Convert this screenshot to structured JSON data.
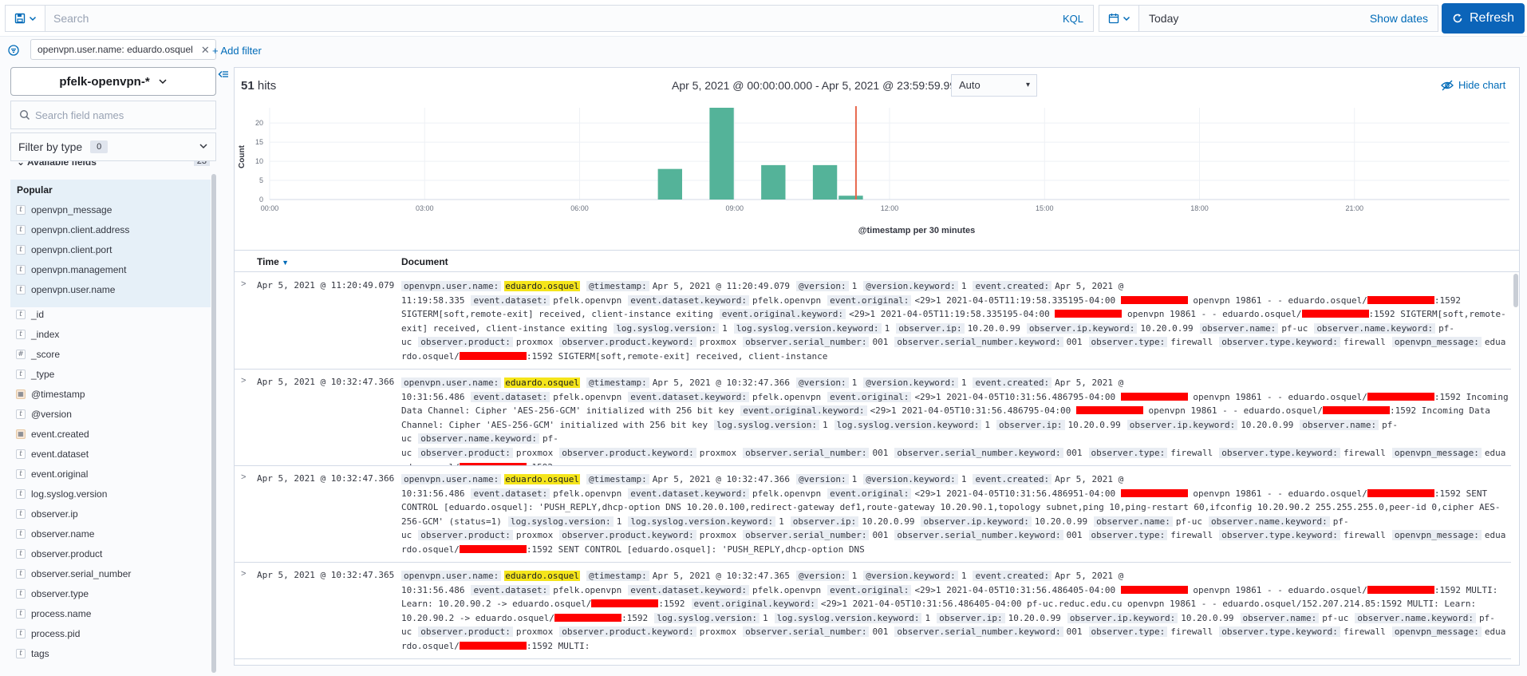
{
  "query": {
    "placeholder": "Search",
    "language": "KQL"
  },
  "time_picker": {
    "value": "Today",
    "show_dates": "Show dates",
    "refresh": "Refresh"
  },
  "filters": {
    "pill": "openvpn.user.name: eduardo.osquel",
    "add": "+ Add filter"
  },
  "sidebar": {
    "index_pattern": "pfelk-openvpn-*",
    "search_placeholder": "Search field names",
    "filter_by_type": "Filter by type",
    "filter_count": "0",
    "available_label": "Available fields",
    "available_count": "23",
    "popular_title": "Popular",
    "popular": [
      {
        "name": "openvpn_message",
        "type": "t"
      },
      {
        "name": "openvpn.client.address",
        "type": "t"
      },
      {
        "name": "openvpn.client.port",
        "type": "t"
      },
      {
        "name": "openvpn.management",
        "type": "t"
      },
      {
        "name": "openvpn.user.name",
        "type": "t"
      }
    ],
    "fields": [
      {
        "name": "_id",
        "type": "t"
      },
      {
        "name": "_index",
        "type": "t"
      },
      {
        "name": "_score",
        "type": "#"
      },
      {
        "name": "_type",
        "type": "t"
      },
      {
        "name": "@timestamp",
        "type": "date"
      },
      {
        "name": "@version",
        "type": "t"
      },
      {
        "name": "event.created",
        "type": "date"
      },
      {
        "name": "event.dataset",
        "type": "t"
      },
      {
        "name": "event.original",
        "type": "t"
      },
      {
        "name": "log.syslog.version",
        "type": "t"
      },
      {
        "name": "observer.ip",
        "type": "t"
      },
      {
        "name": "observer.name",
        "type": "t"
      },
      {
        "name": "observer.product",
        "type": "t"
      },
      {
        "name": "observer.serial_number",
        "type": "t"
      },
      {
        "name": "observer.type",
        "type": "t"
      },
      {
        "name": "process.name",
        "type": "t"
      },
      {
        "name": "process.pid",
        "type": "t"
      },
      {
        "name": "tags",
        "type": "t"
      }
    ]
  },
  "results": {
    "hits": "51",
    "hits_label": "hits",
    "range": "Apr 5, 2021 @ 00:00:00.000 - Apr 5, 2021 @ 23:59:59.999",
    "interval": "Auto",
    "hide_chart": "Hide chart"
  },
  "chart_data": {
    "type": "bar",
    "ylabel": "Count",
    "xlabel": "@timestamp per 30 minutes",
    "x_ticks": [
      "00:00",
      "03:00",
      "06:00",
      "09:00",
      "12:00",
      "15:00",
      "18:00",
      "21:00"
    ],
    "y_ticks": [
      0,
      5,
      10,
      15,
      20
    ],
    "ylim": [
      0,
      24
    ],
    "bars": [
      {
        "hour": 7.5,
        "value": 8
      },
      {
        "hour": 8.5,
        "value": 24
      },
      {
        "hour": 9.5,
        "value": 9
      },
      {
        "hour": 10.5,
        "value": 9
      },
      {
        "hour": 11.0,
        "value": 1
      }
    ],
    "now_marker_hour": 11.35,
    "grid": true,
    "bar_color": "#54b399",
    "marker_color": "#e7664c"
  },
  "table": {
    "time_header": "Time",
    "doc_header": "Document",
    "rows": [
      {
        "time": "Apr 5, 2021 @ 11:20:49.079",
        "doc": [
          [
            "openvpn.user.name:",
            "@@eduardo.osquel@@"
          ],
          [
            "@timestamp:",
            "Apr 5, 2021 @ 11:20:49.079"
          ],
          [
            "@version:",
            "1"
          ],
          [
            "@version.keyword:",
            "1"
          ],
          [
            "event.created:",
            "Apr 5, 2021 @ 11:19:58.335"
          ],
          [
            "event.dataset:",
            "pfelk.openvpn"
          ],
          [
            "event.dataset.keyword:",
            "pfelk.openvpn"
          ],
          [
            "event.original:",
            "<29>1 2021-04-05T11:19:58.335195-04:00 ## openvpn 19861 - - eduardo.osquel/##:1592 SIGTERM[soft,remote-exit] received, client-instance exiting"
          ],
          [
            "event.original.keyword:",
            "<29>1 2021-04-05T11:19:58.335195-04:00 ## openvpn 19861 - - eduardo.osquel/##:1592 SIGTERM[soft,remote-exit] received, client-instance exiting"
          ],
          [
            "log.syslog.version:",
            "1"
          ],
          [
            "log.syslog.version.keyword:",
            "1"
          ],
          [
            "observer.ip:",
            "10.20.0.99"
          ],
          [
            "observer.ip.keyword:",
            "10.20.0.99"
          ],
          [
            "observer.name:",
            "pf-uc"
          ],
          [
            "observer.name.keyword:",
            "pf-uc"
          ],
          [
            "observer.product:",
            "proxmox"
          ],
          [
            "observer.product.keyword:",
            "proxmox"
          ],
          [
            "observer.serial_number:",
            "001"
          ],
          [
            "observer.serial_number.keyword:",
            "001"
          ],
          [
            "observer.type:",
            "firewall"
          ],
          [
            "observer.type.keyword:",
            "firewall"
          ],
          [
            "openvpn_message:",
            "eduardo.osquel/##:1592 SIGTERM[soft,remote-exit] received, client-instance"
          ]
        ]
      },
      {
        "time": "Apr 5, 2021 @ 10:32:47.366",
        "doc": [
          [
            "openvpn.user.name:",
            "@@eduardo.osquel@@"
          ],
          [
            "@timestamp:",
            "Apr 5, 2021 @ 10:32:47.366"
          ],
          [
            "@version:",
            "1"
          ],
          [
            "@version.keyword:",
            "1"
          ],
          [
            "event.created:",
            "Apr 5, 2021 @ 10:31:56.486"
          ],
          [
            "event.dataset:",
            "pfelk.openvpn"
          ],
          [
            "event.dataset.keyword:",
            "pfelk.openvpn"
          ],
          [
            "event.original:",
            "<29>1 2021-04-05T10:31:56.486795-04:00 ## openvpn 19861 - - eduardo.osquel/##:1592 Incoming Data Channel: Cipher 'AES-256-GCM' initialized with 256 bit key"
          ],
          [
            "event.original.keyword:",
            "<29>1 2021-04-05T10:31:56.486795-04:00 ## openvpn 19861 - - eduardo.osquel/##:1592 Incoming Data Channel: Cipher 'AES-256-GCM' initialized with 256 bit key"
          ],
          [
            "log.syslog.version:",
            "1"
          ],
          [
            "log.syslog.version.keyword:",
            "1"
          ],
          [
            "observer.ip:",
            "10.20.0.99"
          ],
          [
            "observer.ip.keyword:",
            "10.20.0.99"
          ],
          [
            "observer.name:",
            "pf-uc"
          ],
          [
            "observer.name.keyword:",
            "pf-uc"
          ],
          [
            "observer.product:",
            "proxmox"
          ],
          [
            "observer.product.keyword:",
            "proxmox"
          ],
          [
            "observer.serial_number:",
            "001"
          ],
          [
            "observer.serial_number.keyword:",
            "001"
          ],
          [
            "observer.type:",
            "firewall"
          ],
          [
            "observer.type.keyword:",
            "firewall"
          ],
          [
            "openvpn_message:",
            "eduardo.osquel/##:1592"
          ]
        ]
      },
      {
        "time": "Apr 5, 2021 @ 10:32:47.366",
        "doc": [
          [
            "openvpn.user.name:",
            "@@eduardo.osquel@@"
          ],
          [
            "@timestamp:",
            "Apr 5, 2021 @ 10:32:47.366"
          ],
          [
            "@version:",
            "1"
          ],
          [
            "@version.keyword:",
            "1"
          ],
          [
            "event.created:",
            "Apr 5, 2021 @ 10:31:56.486"
          ],
          [
            "event.dataset:",
            "pfelk.openvpn"
          ],
          [
            "event.dataset.keyword:",
            "pfelk.openvpn"
          ],
          [
            "event.original:",
            "<29>1 2021-04-05T10:31:56.486951-04:00 ## openvpn 19861 - - eduardo.osquel/##:1592 SENT CONTROL [eduardo.osquel]: 'PUSH_REPLY,dhcp-option DNS 10.20.0.100,redirect-gateway def1,route-gateway 10.20.90.1,topology subnet,ping 10,ping-restart 60,ifconfig 10.20.90.2 255.255.255.0,peer-id 0,cipher AES-256-GCM' (status=1)"
          ],
          [
            "log.syslog.version:",
            "1"
          ],
          [
            "log.syslog.version.keyword:",
            "1"
          ],
          [
            "observer.ip:",
            "10.20.0.99"
          ],
          [
            "observer.ip.keyword:",
            "10.20.0.99"
          ],
          [
            "observer.name:",
            "pf-uc"
          ],
          [
            "observer.name.keyword:",
            "pf-uc"
          ],
          [
            "observer.product:",
            "proxmox"
          ],
          [
            "observer.product.keyword:",
            "proxmox"
          ],
          [
            "observer.serial_number:",
            "001"
          ],
          [
            "observer.serial_number.keyword:",
            "001"
          ],
          [
            "observer.type:",
            "firewall"
          ],
          [
            "observer.type.keyword:",
            "firewall"
          ],
          [
            "openvpn_message:",
            "eduardo.osquel/##:1592 SENT CONTROL [eduardo.osquel]: 'PUSH_REPLY,dhcp-option DNS"
          ]
        ]
      },
      {
        "time": "Apr 5, 2021 @ 10:32:47.365",
        "doc": [
          [
            "openvpn.user.name:",
            "@@eduardo.osquel@@"
          ],
          [
            "@timestamp:",
            "Apr 5, 2021 @ 10:32:47.365"
          ],
          [
            "@version:",
            "1"
          ],
          [
            "@version.keyword:",
            "1"
          ],
          [
            "event.created:",
            "Apr 5, 2021 @ 10:31:56.486"
          ],
          [
            "event.dataset:",
            "pfelk.openvpn"
          ],
          [
            "event.dataset.keyword:",
            "pfelk.openvpn"
          ],
          [
            "event.original:",
            "<29>1 2021-04-05T10:31:56.486405-04:00 ## openvpn 19861 - - eduardo.osquel/##:1592 MULTI: Learn: 10.20.90.2 -> eduardo.osquel/##:1592"
          ],
          [
            "event.original.keyword:",
            "<29>1 2021-04-05T10:31:56.486405-04:00 pf-uc.reduc.edu.cu openvpn 19861 - - eduardo.osquel/152.207.214.85:1592 MULTI: Learn: 10.20.90.2 -> eduardo.osquel/##:1592"
          ],
          [
            "log.syslog.version:",
            "1"
          ],
          [
            "log.syslog.version.keyword:",
            "1"
          ],
          [
            "observer.ip:",
            "10.20.0.99"
          ],
          [
            "observer.ip.keyword:",
            "10.20.0.99"
          ],
          [
            "observer.name:",
            "pf-uc"
          ],
          [
            "observer.name.keyword:",
            "pf-uc"
          ],
          [
            "observer.product:",
            "proxmox"
          ],
          [
            "observer.product.keyword:",
            "proxmox"
          ],
          [
            "observer.serial_number:",
            "001"
          ],
          [
            "observer.serial_number.keyword:",
            "001"
          ],
          [
            "observer.type:",
            "firewall"
          ],
          [
            "observer.type.keyword:",
            "firewall"
          ],
          [
            "openvpn_message:",
            "eduardo.osquel/##:1592 MULTI:"
          ]
        ]
      }
    ]
  }
}
